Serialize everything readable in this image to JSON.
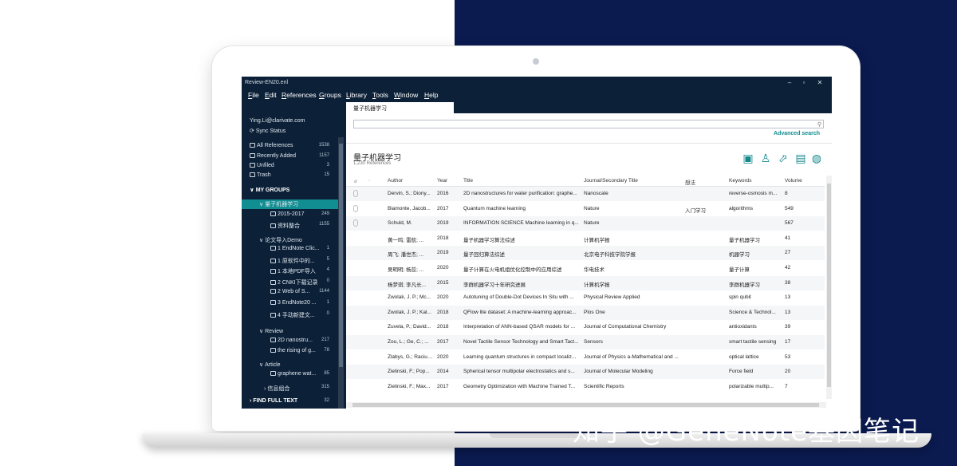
{
  "window": {
    "title": "Review-EN20.enl"
  },
  "menu": [
    {
      "label": "File",
      "accel": "F",
      "rest": "ile"
    },
    {
      "label": "Edit",
      "accel": "E",
      "rest": "dit"
    },
    {
      "label": "References",
      "accel": "R",
      "rest": "eferences"
    },
    {
      "label": "Groups",
      "accel": "G",
      "rest": "roups"
    },
    {
      "label": "Library",
      "accel": "L",
      "rest": "ibrary"
    },
    {
      "label": "Tools",
      "accel": "T",
      "rest": "ools"
    },
    {
      "label": "Window",
      "accel": "W",
      "rest": "indow"
    },
    {
      "label": "Help",
      "accel": "H",
      "rest": "elp"
    }
  ],
  "tab": {
    "label": "量子机器学习"
  },
  "sidebar": {
    "account": "Ying.Li@clarivate.com",
    "sync": "Sync Status",
    "library": [
      {
        "label": "All References",
        "count": "1538"
      },
      {
        "label": "Recently Added",
        "count": "1157"
      },
      {
        "label": "Unfiled",
        "count": "3"
      },
      {
        "label": "Trash",
        "count": "15"
      }
    ],
    "my_groups": "MY GROUPS",
    "set1": {
      "label": "量子机器学习",
      "items": [
        {
          "label": "2015-2017",
          "count": "249"
        },
        {
          "label": "资料整合",
          "count": "1155"
        }
      ]
    },
    "set2": {
      "label": "论文导入Demo",
      "items": [
        {
          "label": "1 EndNote Clic...",
          "count": "1"
        },
        {
          "label": "1 原软件中的...",
          "count": "5"
        },
        {
          "label": "1 本地PDF导入",
          "count": "4"
        },
        {
          "label": "2 CNKI下载记录",
          "count": "0"
        },
        {
          "label": "2 Web of S...",
          "count": "1144"
        },
        {
          "label": "3 EndNote20 ...",
          "count": "1"
        },
        {
          "label": "4 手动新建文...",
          "count": "0"
        }
      ]
    },
    "set3": {
      "label": "Review",
      "items": [
        {
          "label": "2D nanostru...",
          "count": "217"
        },
        {
          "label": "the rising of g...",
          "count": "78"
        }
      ]
    },
    "set4": {
      "label": "Article",
      "items": [
        {
          "label": "graphene wat...",
          "count": "85"
        }
      ]
    },
    "set5": {
      "label": "信息组合",
      "count": "315"
    },
    "find_full_text": {
      "label": "FIND FULL TEXT",
      "count": "32"
    }
  },
  "search": {
    "placeholder": "",
    "advanced": "Advanced search"
  },
  "group": {
    "title": "量子机器学习",
    "count_text": "1,230 References"
  },
  "toolbar_icons": [
    "clipboard-plus-icon",
    "add-user-icon",
    "share-icon",
    "pdf-icon",
    "globe-icon"
  ],
  "table": {
    "headers": {
      "author": "Author",
      "year": "Year",
      "title": "Title",
      "journal": "Journal/Secondary Title",
      "notes": "想法",
      "keywords": "Keywords",
      "volume": "Volume"
    },
    "rows": [
      {
        "attach": true,
        "author": "Dervin, S.; Diony...",
        "year": "2016",
        "title": "2D nanostructures for water purification: graphe...",
        "journal": "Nanoscale",
        "notes": "",
        "keywords": "reverse-osmosis m...",
        "volume": "8"
      },
      {
        "attach": true,
        "author": "Biamonte, Jacob...",
        "year": "2017",
        "title": "Quantum machine learning",
        "journal": "Nature",
        "notes": "入门学习",
        "keywords": "algorithms",
        "volume": "549"
      },
      {
        "attach": true,
        "author": "Schuld, M.",
        "year": "2019",
        "title": "INFORMATION SCIENCE Machine learning in q...",
        "journal": "Nature",
        "notes": "",
        "keywords": "",
        "volume": "567"
      },
      {
        "attach": false,
        "author": "黄一鸣; 雷航; ...",
        "year": "2018",
        "title": "量子机器学习算法综述",
        "journal": "计算机学报",
        "notes": "",
        "keywords": "量子机器学习",
        "volume": "41"
      },
      {
        "attach": false,
        "author": "周飞; 潘世杰; ...",
        "year": "2019",
        "title": "量子回归算法综述",
        "journal": "北京电子科技学院学报",
        "notes": "",
        "keywords": "机器学习",
        "volume": "27"
      },
      {
        "attach": false,
        "author": "吴明明; 杨蕊; ...",
        "year": "2020",
        "title": "量子计算在火电机组优化控制中的应用综述",
        "journal": "华电技术",
        "notes": "",
        "keywords": "量子计算",
        "volume": "42"
      },
      {
        "attach": false,
        "author": "杨梦琪; 李凡长...",
        "year": "2015",
        "title": "李群机器学习十年研究进展",
        "journal": "计算机学报",
        "notes": "",
        "keywords": "李群机器学习",
        "volume": "38"
      },
      {
        "attach": false,
        "author": "Zwolak, J. P.; Mc...",
        "year": "2020",
        "title": "Autotuning of Double-Dot Devices In Situ with ...",
        "journal": "Physical Review Applied",
        "notes": "",
        "keywords": "spin qubit",
        "volume": "13"
      },
      {
        "attach": false,
        "author": "Zwolak, J. P.; Kal...",
        "year": "2018",
        "title": "QFlow lite dataset: A machine-learning approac...",
        "journal": "Plos One",
        "notes": "",
        "keywords": "Science & Technol...",
        "volume": "13"
      },
      {
        "attach": false,
        "author": "Zuvela, P.; David...",
        "year": "2018",
        "title": "Interpretation of ANN-based QSAR models for ...",
        "journal": "Journal of Computational Chemistry",
        "notes": "",
        "keywords": "antioxidants",
        "volume": "39"
      },
      {
        "attach": false,
        "author": "Zou, L.; Ge, C.; ...",
        "year": "2017",
        "title": "Novel Tactile Sensor Technology and Smart Tact...",
        "journal": "Sensors",
        "notes": "",
        "keywords": "smart tactile sensing",
        "volume": "17"
      },
      {
        "attach": false,
        "author": "Zlabys, G.; Racius...",
        "year": "2020",
        "title": "Learning quantum structures in compact localiz...",
        "journal": "Journal of Physics a-Mathematical and ...",
        "notes": "",
        "keywords": "optical lattice",
        "volume": "53"
      },
      {
        "attach": false,
        "author": "Zielinski, F.; Pop...",
        "year": "2014",
        "title": "Spherical tensor multipolar electrostatics and s...",
        "journal": "Journal of Molecular Modeling",
        "notes": "",
        "keywords": "Force field",
        "volume": "20"
      },
      {
        "attach": false,
        "author": "Zielinski, F.; Max...",
        "year": "2017",
        "title": "Geometry Optimization with Machine Trained T...",
        "journal": "Scientific Reports",
        "notes": "",
        "keywords": "polarizable multip...",
        "volume": "7"
      }
    ]
  },
  "watermark": "知乎 @GeneNote基因笔记",
  "colors": {
    "sidebar": "#0c2138",
    "accent": "#118e91",
    "background_right": "#0b1a4f"
  }
}
